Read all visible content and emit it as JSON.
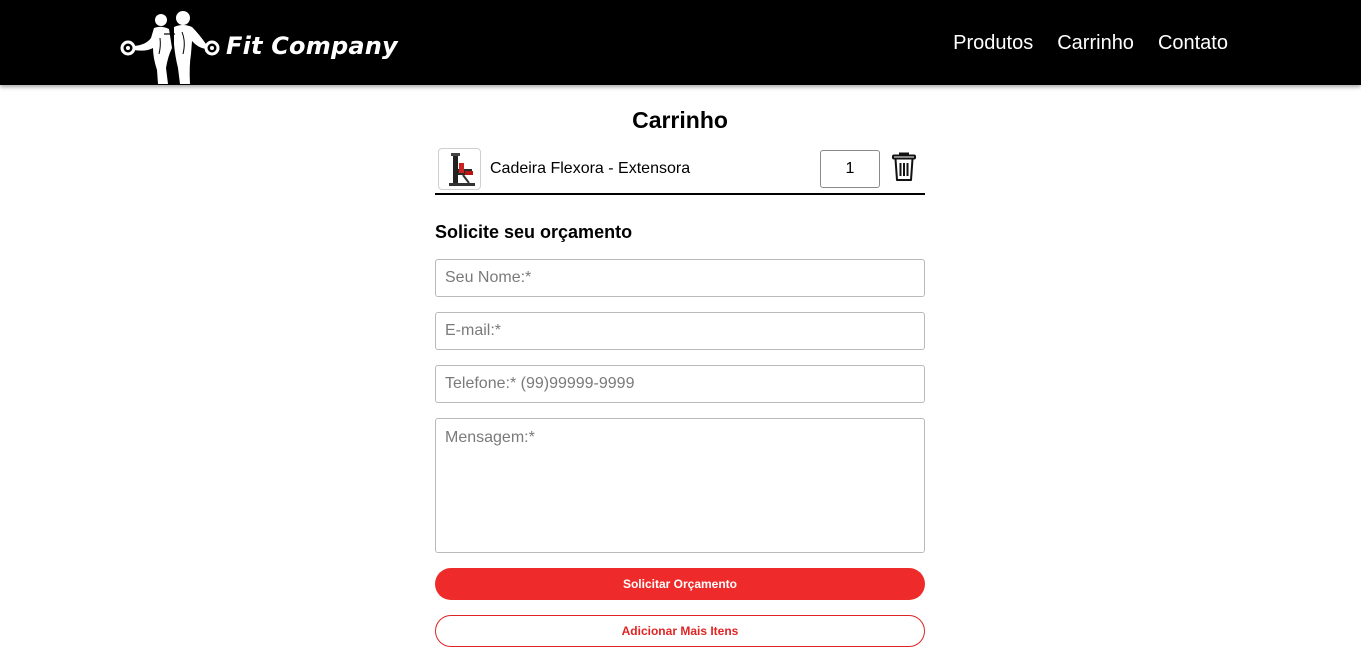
{
  "brand": {
    "name": "Fit Company"
  },
  "nav": {
    "items": [
      "Produtos",
      "Carrinho",
      "Contato"
    ]
  },
  "cart": {
    "title": "Carrinho",
    "items": [
      {
        "name": "Cadeira Flexora - Extensora",
        "quantity": "1"
      }
    ]
  },
  "form": {
    "title": "Solicite seu orçamento",
    "name_placeholder": "Seu Nome:*",
    "email_placeholder": "E-mail:*",
    "phone_placeholder": "Telefone:* (99)99999-9999",
    "message_placeholder": "Mensagem:*",
    "submit_label": "Solicitar Orçamento",
    "add_more_label": "Adicionar Mais Itens"
  },
  "colors": {
    "header_bg": "#000000",
    "accent": "#ef2a2a"
  },
  "icons": {
    "logo": "fitness-couple-logo-icon",
    "delete": "trash-icon",
    "product": "product-thumbnail"
  }
}
